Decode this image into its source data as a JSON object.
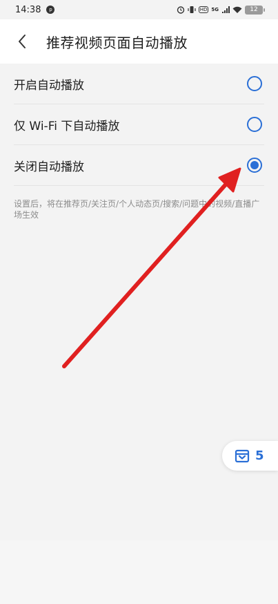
{
  "status_bar": {
    "time": "14:38",
    "notif_icon": "p",
    "hd": "HD",
    "network": "5G",
    "battery": "12"
  },
  "header": {
    "back_icon": "chevron-left-icon",
    "title": "推荐视频页面自动播放"
  },
  "options": [
    {
      "label": "开启自动播放",
      "selected": false
    },
    {
      "label": "仅 Wi-Fi 下自动播放",
      "selected": false
    },
    {
      "label": "关闭自动播放",
      "selected": true
    }
  ],
  "hint": "设置后，将在推荐页/关注页/个人动态页/搜索/问题中的视频/直播广场生效",
  "float_button": {
    "icon": "inbox-icon",
    "count": "5"
  },
  "colors": {
    "accent": "#2a6fd6",
    "arrow": "#e02020",
    "background": "#f3f3f3"
  }
}
